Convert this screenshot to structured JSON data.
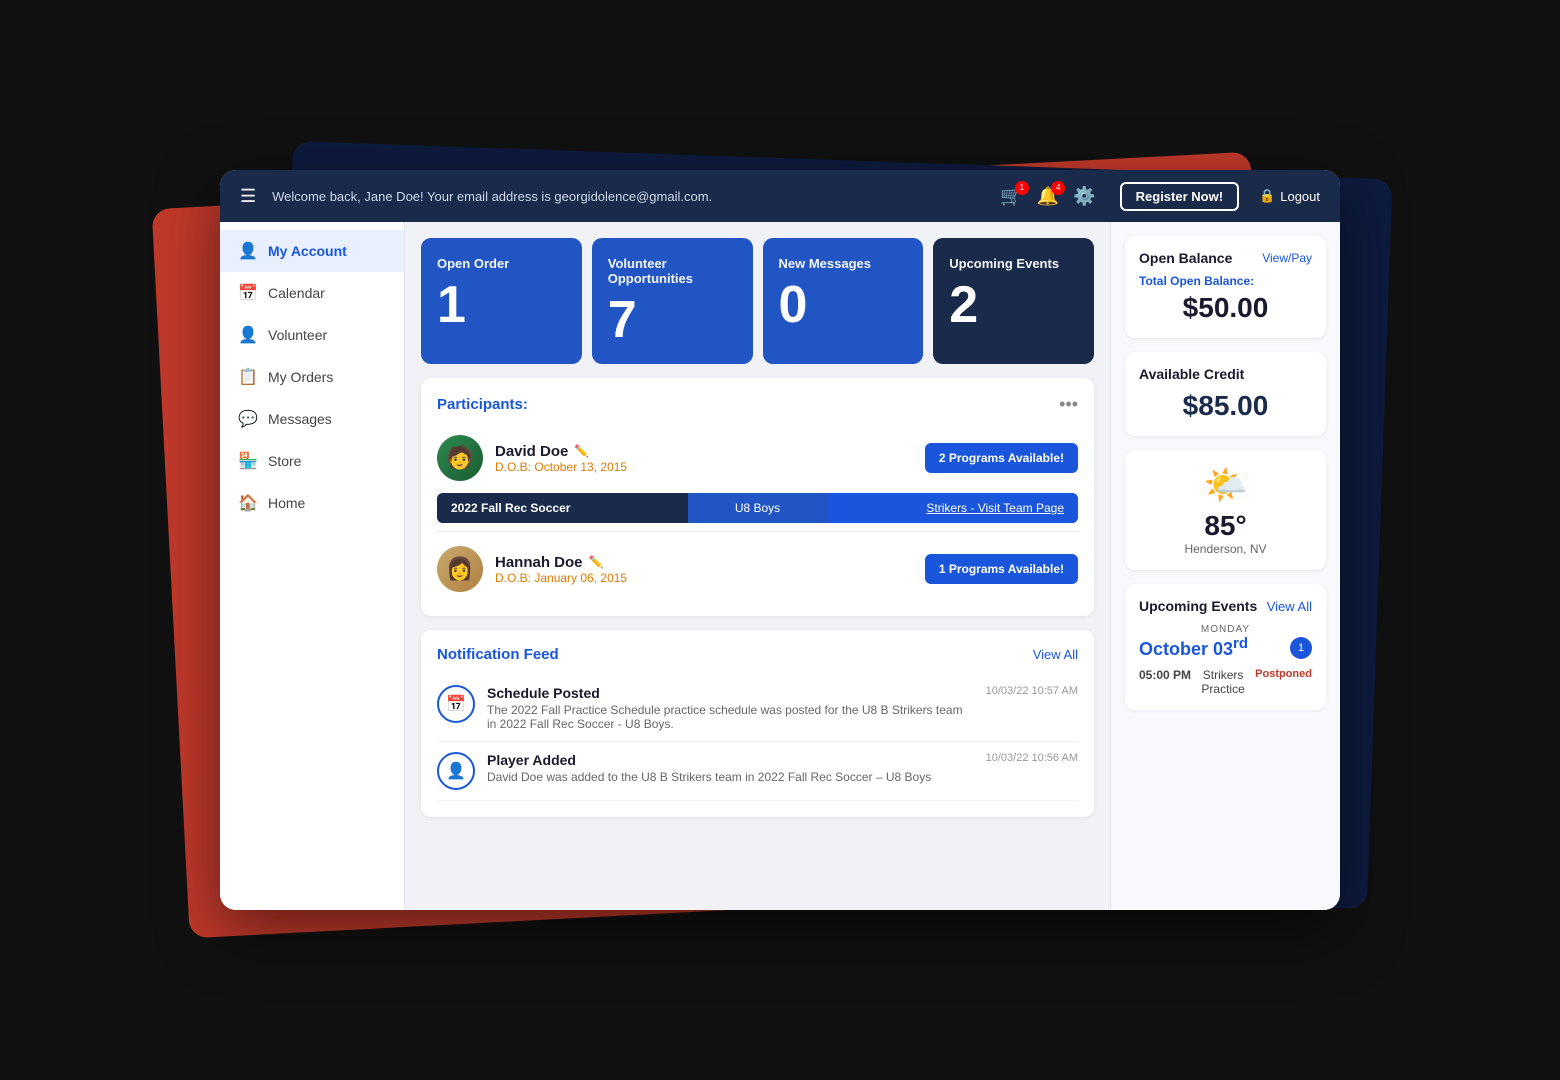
{
  "navbar": {
    "welcome_text": "Welcome back, Jane Doe! Your email address is georgidolence@gmail.com.",
    "cart_badge": "1",
    "bell_badge": "4",
    "register_label": "Register Now!",
    "logout_label": "Logout"
  },
  "sidebar": {
    "items": [
      {
        "label": "My Account",
        "icon": "👤",
        "active": true
      },
      {
        "label": "Calendar",
        "icon": "📅",
        "active": false
      },
      {
        "label": "Volunteer",
        "icon": "👤",
        "active": false
      },
      {
        "label": "My Orders",
        "icon": "📋",
        "active": false
      },
      {
        "label": "Messages",
        "icon": "💬",
        "active": false
      },
      {
        "label": "Store",
        "icon": "🏪",
        "active": false
      },
      {
        "label": "Home",
        "icon": "🏠",
        "active": false
      }
    ]
  },
  "stat_cards": [
    {
      "label": "Open Order",
      "value": "1",
      "theme": "blue"
    },
    {
      "label": "Volunteer Opportunities",
      "value": "7",
      "theme": "blue"
    },
    {
      "label": "New Messages",
      "value": "0",
      "theme": "blue"
    },
    {
      "label": "Upcoming Events",
      "value": "2",
      "theme": "dark"
    }
  ],
  "participants": {
    "title": "Participants:",
    "list": [
      {
        "name": "David Doe",
        "dob_label": "D.O.B:",
        "dob": "October 13, 2015",
        "btn_label": "2 Programs Available!",
        "team_bar": {
          "program": "2022 Fall Rec Soccer",
          "division": "U8 Boys",
          "team": "Strikers - Visit Team Page"
        }
      },
      {
        "name": "Hannah Doe",
        "dob_label": "D.O.B:",
        "dob": "January 06, 2015",
        "btn_label": "1 Programs Available!",
        "team_bar": null
      }
    ]
  },
  "notification_feed": {
    "title": "Notification Feed",
    "view_all": "View All",
    "items": [
      {
        "title": "Schedule Posted",
        "description": "The 2022 Fall Practice Schedule practice schedule was posted for the U8 B Strikers team in 2022 Fall Rec Soccer - U8 Boys.",
        "time": "10/03/22 10:57 AM",
        "icon": "📅"
      },
      {
        "title": "Player Added",
        "description": "David Doe was added to the U8 B Strikers team in 2022 Fall Rec Soccer – U8 Boys",
        "time": "10/03/22 10:56 AM",
        "icon": "👤"
      }
    ]
  },
  "right_panel": {
    "open_balance": {
      "title": "Open Balance",
      "view_pay": "View/Pay",
      "total_label": "Total Open Balance:",
      "amount": "$50.00"
    },
    "available_credit": {
      "title": "Available Credit",
      "amount": "$85.00"
    },
    "weather": {
      "icon": "🌤️",
      "temp": "85°",
      "location": "Henderson, NV"
    },
    "upcoming_events": {
      "title": "Upcoming Events",
      "view_all": "View All",
      "day": "MONDAY",
      "date": "October 03",
      "date_sup": "rd",
      "badge": "1",
      "events": [
        {
          "time": "05:00 PM",
          "name": "Strikers Practice",
          "status": "Postponed"
        }
      ]
    }
  }
}
